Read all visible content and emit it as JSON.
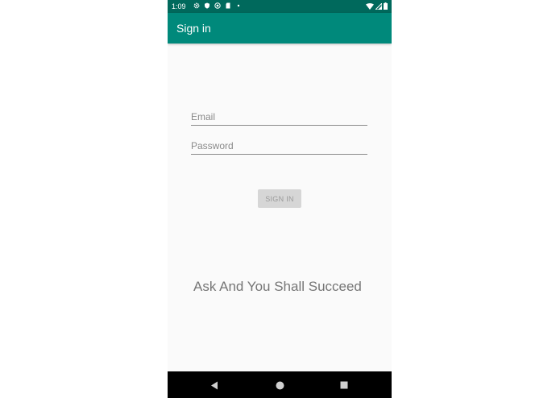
{
  "status_bar": {
    "time": "1:09",
    "icons": [
      "settings-icon",
      "shield-icon",
      "sync-icon",
      "sd-card-icon",
      "notification-dot-icon",
      "wifi-icon",
      "signal-icon",
      "battery-icon"
    ]
  },
  "app_bar": {
    "title": "Sign in",
    "color": "#00897b",
    "status_color": "#00695c"
  },
  "form": {
    "email_placeholder": "Email",
    "email_value": "",
    "password_placeholder": "Password",
    "password_value": "",
    "signin_label": "SIGN IN"
  },
  "tagline": "Ask And You Shall Succeed",
  "nav_bar": {
    "buttons": [
      "back-icon",
      "home-icon",
      "recents-icon"
    ]
  }
}
